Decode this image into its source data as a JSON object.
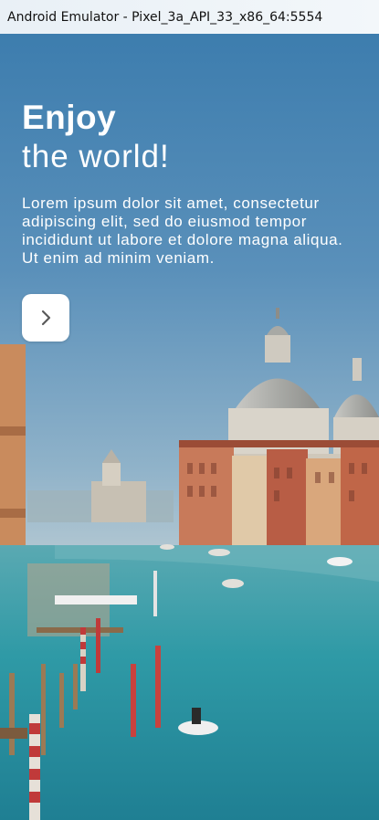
{
  "window": {
    "title": "Android Emulator - Pixel_3a_API_33_x86_64:5554"
  },
  "hero": {
    "title_bold": "Enjoy",
    "title_light": "the world!",
    "body": "Lorem ipsum dolor sit amet, consectetur adipiscing elit, sed do eiusmod tempor incididunt ut labore et dolore magna aliqua. Ut enim ad minim veniam."
  },
  "next_button": {
    "icon": "chevron-right-icon"
  },
  "colors": {
    "sky_top": "#3d7dae",
    "water": "#2d9aa5",
    "text": "#ffffff",
    "button_bg": "#ffffff",
    "chevron": "#5a5a5a"
  }
}
